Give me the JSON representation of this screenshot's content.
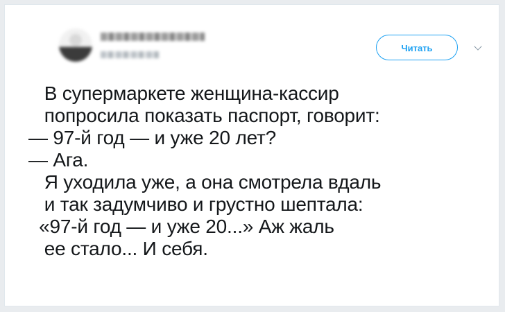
{
  "tweet": {
    "follow_label": "Читать",
    "text_lines": [
      "   В супермаркете женщина-кассир",
      "   попросила показать паспорт, говорит:",
      "— 97-й год — и уже 20 лет?",
      "— Ага.",
      "   Я уходила уже, а она смотрела вдаль",
      "   и так задумчиво и грустно шептала:",
      "  «97-й год — и уже 20...» Аж жаль",
      "   ее стало... И себя."
    ]
  },
  "icons": {
    "more": "chevron-down-icon"
  },
  "colors": {
    "accent": "#1da1f2",
    "text": "#14171a",
    "card": "#ffffff",
    "border": "#e1e8ed"
  }
}
